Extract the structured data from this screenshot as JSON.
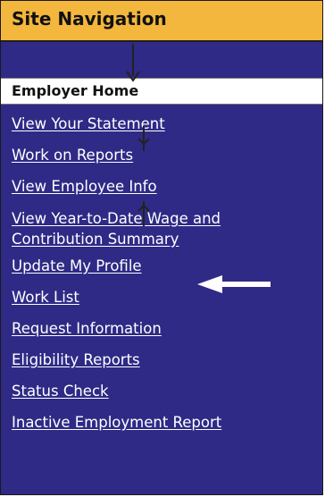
{
  "header": {
    "title": "Site Navigation"
  },
  "active": {
    "label": "Employer Home"
  },
  "nav": {
    "items": [
      "View Your Statement",
      "Work on Reports",
      "View Employee Info",
      "View Year-to-Date Wage and Contribution Summary",
      "Update My Profile",
      "Work List",
      "Request Information",
      "Eligibility Reports",
      "Status Check",
      "Inactive Employment Report"
    ]
  },
  "colors": {
    "header_bg": "#f2b73c",
    "panel_bg": "#2f2a86",
    "link": "#ffffff"
  },
  "annotation": {
    "arrow_target": "Update My Profile",
    "arrow_color": "#ffffff"
  }
}
